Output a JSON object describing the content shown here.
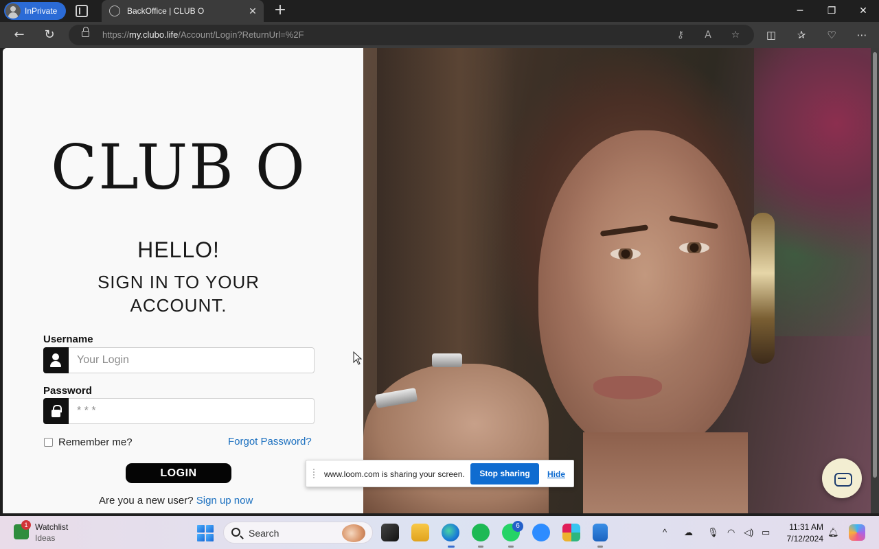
{
  "browser": {
    "profile_label": "InPrivate",
    "tab_title": "BackOffice | CLUB O",
    "url_scheme": "https://",
    "url_host": "my.clubo.life",
    "url_path": "/Account/Login?ReturnUrl=%2F"
  },
  "login": {
    "logo": "CLUB O",
    "greeting": "HELLO!",
    "heading": "SIGN IN TO YOUR ACCOUNT.",
    "username_label": "Username",
    "username_placeholder": "Your Login",
    "password_label": "Password",
    "password_placeholder": "* * *",
    "remember_label": "Remember me?",
    "forgot_label": "Forgot Password?",
    "login_button": "LOGIN",
    "new_user_text": "Are you a new user?",
    "signup_link": "Sign up now"
  },
  "loom": {
    "message": "www.loom.com is sharing your screen.",
    "stop_label": "Stop sharing",
    "hide_label": "Hide"
  },
  "taskbar": {
    "widget_title": "Watchlist",
    "widget_sub": "Ideas",
    "widget_badge": "1",
    "search_label": "Search",
    "whatsapp_badge": "6",
    "time": "11:31 AM",
    "date": "7/12/2024",
    "apps": [
      "task-view",
      "file-explorer",
      "edge",
      "spotify",
      "whatsapp",
      "zoom",
      "slack",
      "notepad"
    ]
  },
  "colors": {
    "link": "#1a6fbf",
    "loom_blue": "#0f6cd0",
    "inprivate_blue": "#2b6bd6"
  }
}
